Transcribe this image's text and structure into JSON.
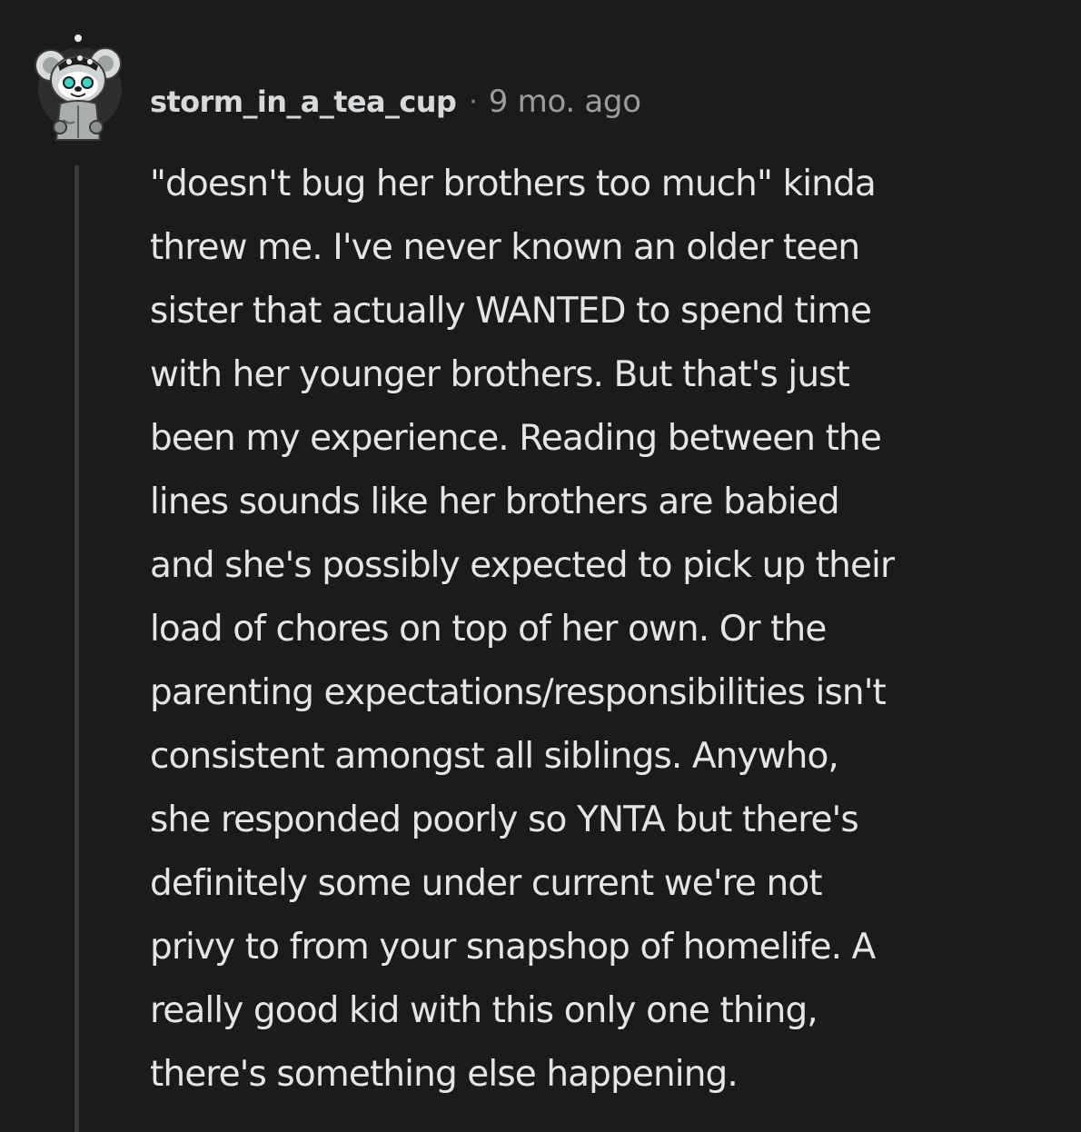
{
  "comment": {
    "author": "storm_in_a_tea_cup",
    "separator": "·",
    "timestamp": "9 mo. ago",
    "avatar_icon": "snoo-koala-avatar-icon",
    "body_lines": [
      "\"doesn't bug her brothers too much\" kinda",
      "threw me. I've never known an older teen",
      "sister that actually WANTED to spend time",
      "with her younger brothers. But that's just",
      "been my experience. Reading between the",
      "lines sounds like her brothers are babied",
      "and she's possibly expected to pick up their",
      "load of chores on top of her own. Or the",
      "parenting expectations/responsibilities isn't",
      "consistent amongst all siblings. Anywho,",
      "she responded poorly so YNTA but there's",
      "definitely some under current we're not",
      "privy to from your snapshop of homelife. A",
      "really good kid with this only one thing,",
      "there's something else happening."
    ]
  },
  "colors": {
    "background": "#1b1b1b",
    "text": "#e3e5e7",
    "author": "#d7dadc",
    "meta": "#9a9c9e",
    "thread_line": "#3a3a3a"
  }
}
